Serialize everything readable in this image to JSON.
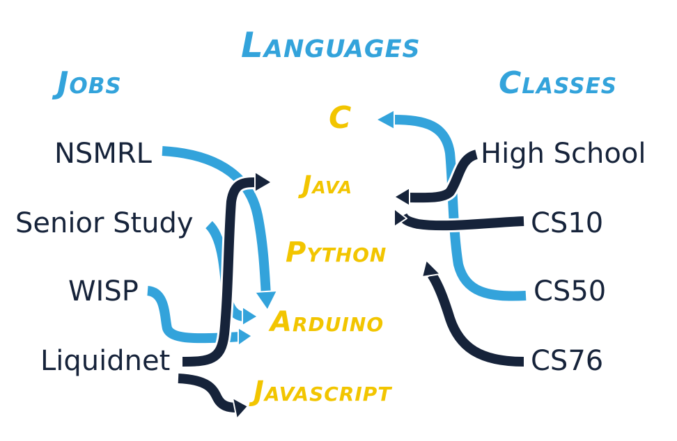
{
  "headings": {
    "languages": "Languages",
    "jobs": "Jobs",
    "classes": "Classes"
  },
  "languages": [
    "C",
    "Java",
    "Python",
    "Arduino",
    "Javascript"
  ],
  "jobs": [
    "NSMRL",
    "Senior Study",
    "WISP",
    "Liquidnet"
  ],
  "classes": [
    "High School",
    "CS10",
    "CS50",
    "CS76"
  ],
  "connections": [
    {
      "from": "NSMRL",
      "to": "Arduino",
      "color": "light"
    },
    {
      "from": "Senior Study",
      "to": "Arduino",
      "color": "light"
    },
    {
      "from": "WISP",
      "to": "Arduino",
      "color": "light"
    },
    {
      "from": "Liquidnet",
      "to": "Java",
      "color": "dark"
    },
    {
      "from": "Liquidnet",
      "to": "Javascript",
      "color": "dark"
    },
    {
      "from": "High School",
      "to": "Java",
      "color": "dark"
    },
    {
      "from": "CS10",
      "to": "Java",
      "color": "dark"
    },
    {
      "from": "CS50",
      "to": "C",
      "color": "light"
    },
    {
      "from": "CS76",
      "to": "Python",
      "color": "dark"
    }
  ],
  "colors": {
    "heading": "#33a3db",
    "language": "#f2c500",
    "item_text": "#16233a",
    "arrow_light": "#33a3db",
    "arrow_dark": "#16233a"
  }
}
